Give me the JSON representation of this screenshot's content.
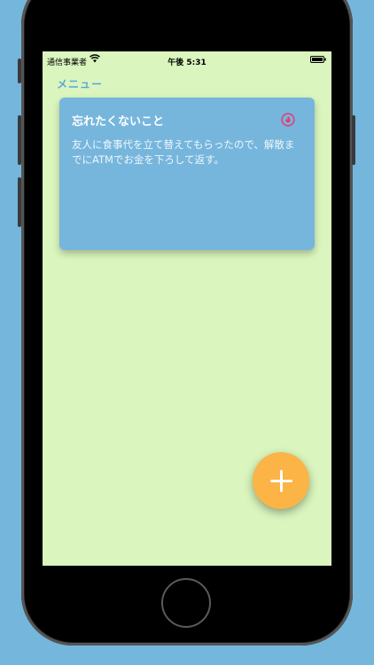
{
  "status_bar": {
    "carrier": "通信事業者",
    "time": "午後 5:31"
  },
  "nav": {
    "menu_label": "メニュー"
  },
  "notes": [
    {
      "title": "忘れたくないこと",
      "body": "友人に食事代を立て替えてもらったので、解散までにATMでお金を下ろして返す。",
      "icon": "fire-icon"
    }
  ],
  "fab": {
    "icon": "plus-icon"
  },
  "colors": {
    "background": "#74b6dc",
    "screen": "#daf5bd",
    "card": "#76b6dc",
    "accent": "#5aa7dd",
    "fab": "#fbb445",
    "icon_pink": "#e0407a"
  }
}
